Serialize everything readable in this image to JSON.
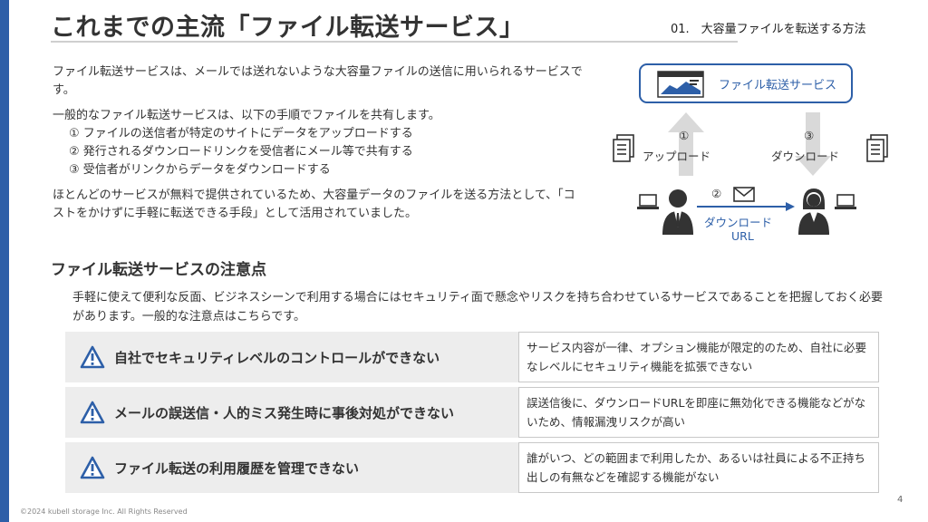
{
  "header": {
    "title": "これまでの主流「ファイル転送サービス」",
    "section_label": "01.　大容量ファイルを転送する方法"
  },
  "intro": {
    "p1": "ファイル転送サービスは、メールでは送れないような大容量ファイルの送信に用いられるサービスです。",
    "p2": "一般的なファイル転送サービスは、以下の手順でファイルを共有します。",
    "steps": [
      "① ファイルの送信者が特定のサイトにデータをアップロードする",
      "② 発行されるダウンロードリンクを受信者にメール等で共有する",
      "③ 受信者がリンクからデータをダウンロードする"
    ],
    "p3": "ほとんどのサービスが無料で提供されているため、大容量データのファイルを送る方法として、「コストをかけずに手軽に転送できる手段」として活用されていました。"
  },
  "diagram": {
    "service_label": "ファイル転送サービス",
    "upload_num": "①",
    "upload_label": "アップロード",
    "download_num": "③",
    "download_label": "ダウンロード",
    "share_num": "②",
    "share_label": "ダウンロード",
    "share_url": "URL",
    "colors": {
      "accent": "#2d5fa8",
      "arrow": "#d9d9d9",
      "ink": "#333333"
    }
  },
  "notes": {
    "heading": "ファイル転送サービスの注意点",
    "intro": "手軽に使えて便利な反面、ビジネスシーンで利用する場合にはセキュリティ面で懸念やリスクを持ち合わせているサービスであることを把握しておく必要があります。一般的な注意点はこちらです。",
    "items": [
      {
        "title": "自社でセキュリティレベルのコントロールができない",
        "desc": "サービス内容が一律、オプション機能が限定的のため、自社に必要なレベルにセキュリティ機能を拡張できない"
      },
      {
        "title": "メールの誤送信・人的ミス発生時に事後対処ができない",
        "desc": "誤送信後に、ダウンロードURLを即座に無効化できる機能などがないため、情報漏洩リスクが高い"
      },
      {
        "title": "ファイル転送の利用履歴を管理できない",
        "desc": "誰がいつ、どの範囲まで利用したか、あるいは社員による不正持ち出しの有無などを確認する機能がない"
      }
    ]
  },
  "footer": {
    "copyright": "©2024 kubell storage Inc. All Rights Reserved",
    "page_number": "4"
  }
}
